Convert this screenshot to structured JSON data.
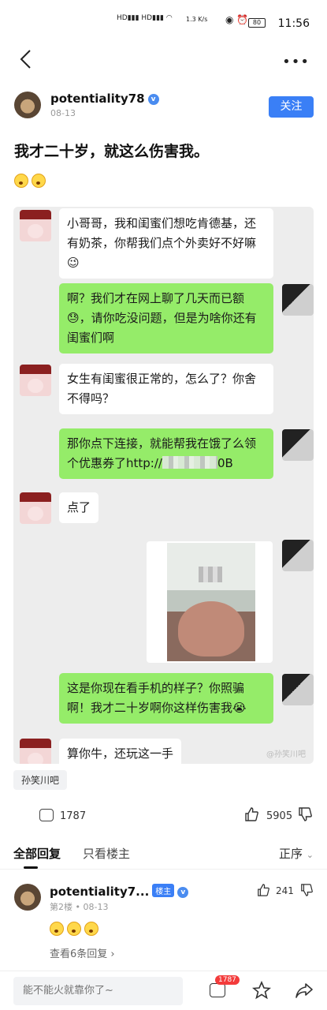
{
  "status_bar": {
    "net_speed": "1.3\nK/s",
    "battery": "80",
    "time": "11:56"
  },
  "post": {
    "author": "potentiality78",
    "date": "08-13",
    "follow_label": "关注",
    "title": "我才二十岁，就这么伤害我。"
  },
  "chat": {
    "messages": [
      {
        "side": "left",
        "text": "小哥哥，我和闺蜜们想吃肯德基，还有奶茶，你帮我们点个外卖好不好嘛😉"
      },
      {
        "side": "right",
        "text": "啊？我们才在网上聊了几天而已额😓，请你吃没问题，但是为啥你还有闺蜜们啊"
      },
      {
        "side": "left",
        "text": "女生有闺蜜很正常的，怎么了？你舍不得吗？"
      },
      {
        "side": "right",
        "text_pre": "那你点下连接，就能帮我在饿了么领个优惠券了http://",
        "text_post": "0B"
      },
      {
        "side": "left",
        "text": "点了"
      },
      {
        "side": "right",
        "type": "image"
      },
      {
        "side": "right",
        "text": "这是你现在看手机的样子？你照骗啊！我才二十岁啊你这样伤害我😭"
      },
      {
        "side": "left",
        "text": "算你牛，还玩这一手"
      }
    ],
    "watermark": "@孙笑川吧"
  },
  "tag": "孙笑川吧",
  "actions": {
    "comment_count": "1787",
    "like_count": "5905"
  },
  "tabs": {
    "all": "全部回复",
    "op_only": "只看楼主",
    "sort": "正序"
  },
  "reply": {
    "name": "potentiality7...",
    "op_badge": "楼主",
    "floor": "第2楼",
    "date": "08-13",
    "like_count": "241",
    "more": "查看6条回复"
  },
  "bottom_bar": {
    "input_placeholder": "能不能火就靠你了~",
    "badge_count": "1787"
  },
  "icons": [
    "back-icon",
    "more-icon",
    "verified-icon",
    "comment-icon",
    "like-icon",
    "dislike-icon",
    "chevron-down-icon",
    "star-icon",
    "share-icon"
  ]
}
